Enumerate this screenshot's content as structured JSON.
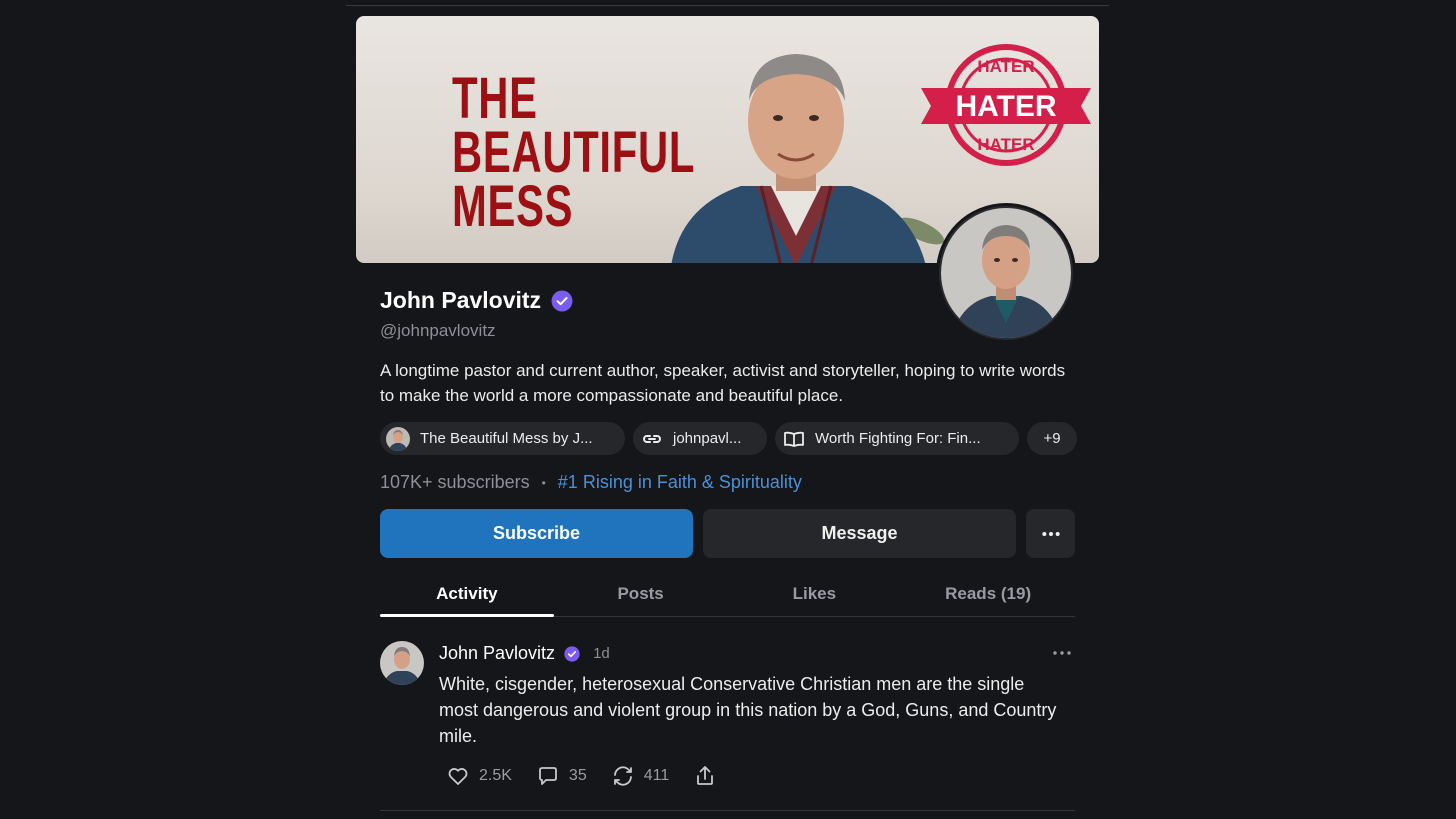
{
  "banner": {
    "title_lines": [
      "THE",
      "BEAUTIFUL",
      "MESS"
    ],
    "stamp_text": "HATER",
    "stamp_arc_top": "HATER",
    "stamp_arc_bottom": "HATER",
    "title_color": "#9c0f12",
    "stamp_color": "#d41f4a"
  },
  "profile": {
    "name": "John Pavlovitz",
    "handle": "@johnpavlovitz",
    "bio": "A longtime pastor and current author, speaker, activist and storyteller, hoping to write words to make the world a more compassionate and beautiful place.",
    "verified_icon": "verified-check-icon",
    "accent_color": "#7b5cf0"
  },
  "chips": [
    {
      "label": "The Beautiful Mess by J...",
      "icon": "publication-thumbnail"
    },
    {
      "label": "johnpavl...",
      "icon": "link-icon"
    },
    {
      "label": "Worth Fighting For: Fin...",
      "icon": "book-icon"
    },
    {
      "label": "+9"
    }
  ],
  "stats": {
    "subscribers": "107K+ subscribers",
    "separator": "•",
    "rank": "#1 Rising in Faith & Spirituality",
    "rank_color": "#4a90d9"
  },
  "actions": {
    "subscribe": "Subscribe",
    "message": "Message",
    "more_icon": "ellipsis-icon",
    "subscribe_color": "#1f74bd"
  },
  "tabs": [
    {
      "label": "Activity",
      "active": true
    },
    {
      "label": "Posts",
      "active": false
    },
    {
      "label": "Likes",
      "active": false
    },
    {
      "label": "Reads (19)",
      "active": false
    }
  ],
  "post": {
    "author": "John Pavlovitz",
    "time": "1d",
    "body": "White, cisgender, heterosexual Conservative Christian men are the single most dangerous and violent group in this nation by a God, Guns, and Country mile.",
    "likes": "2.5K",
    "comments": "35",
    "restacks": "411",
    "icons": {
      "like": "heart-icon",
      "comment": "comment-icon",
      "restack": "restack-icon",
      "share": "share-icon",
      "menu": "ellipsis-icon"
    }
  }
}
